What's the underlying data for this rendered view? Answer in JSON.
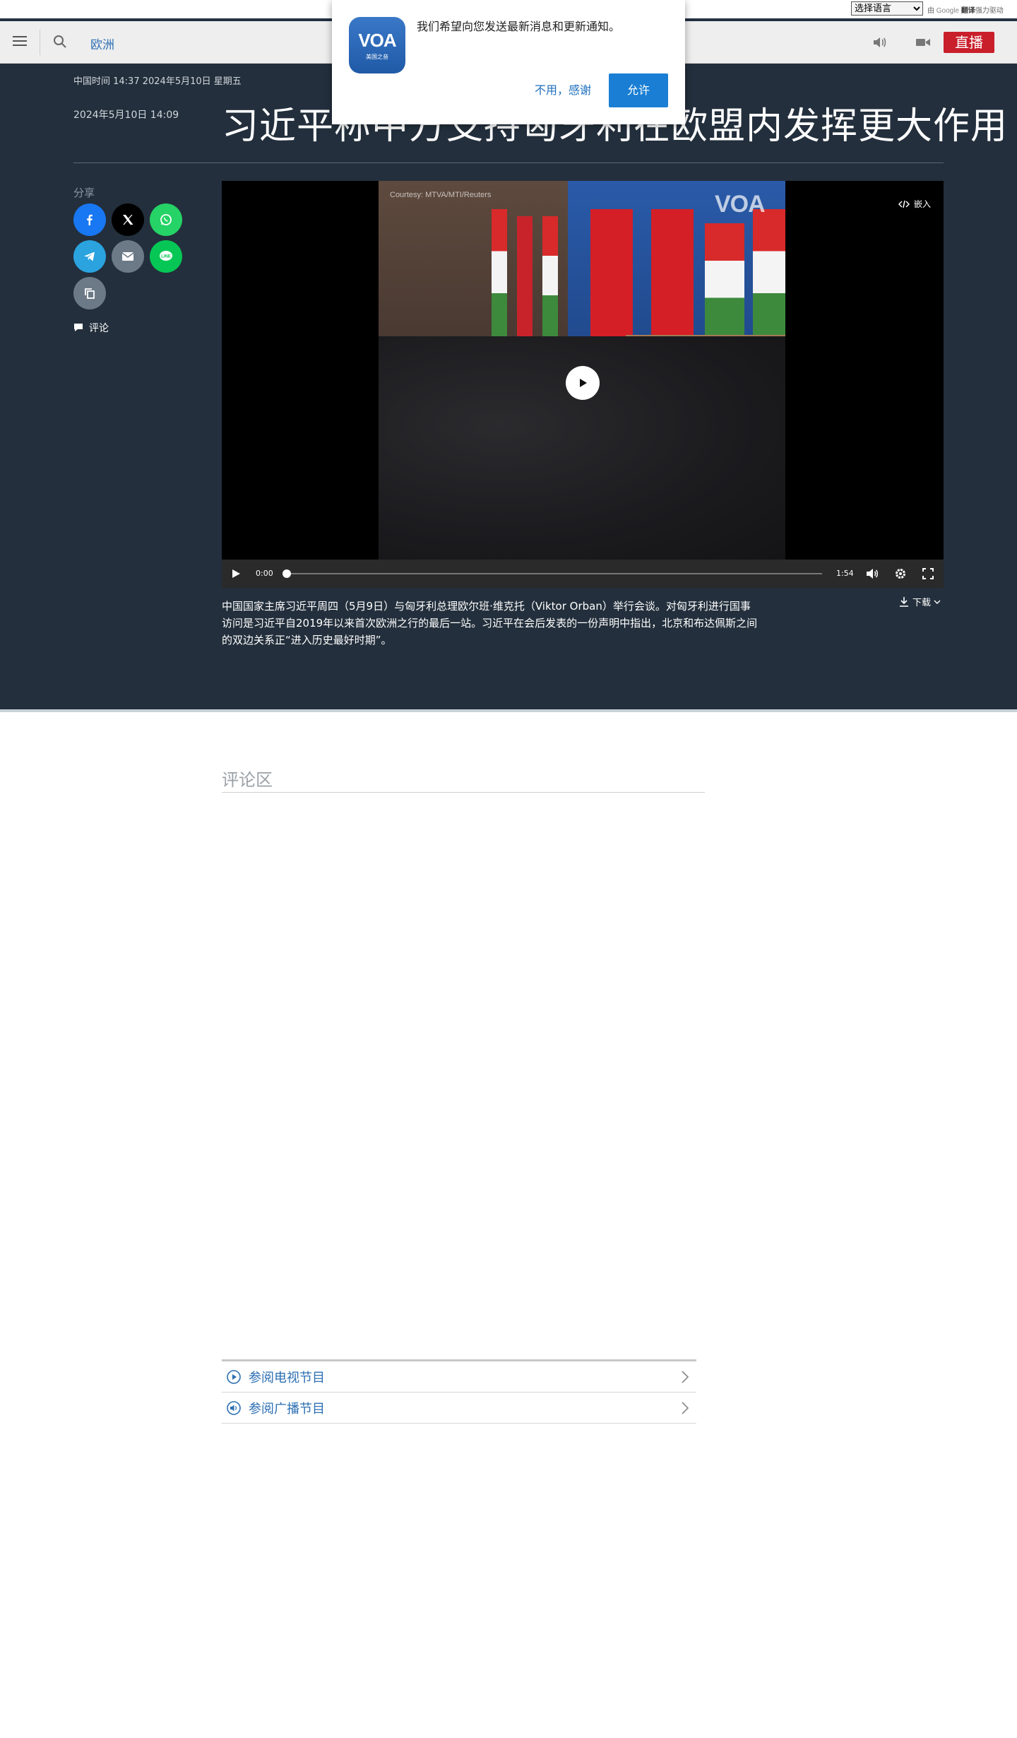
{
  "translate_bar": {
    "select_value": "选择语言",
    "powered_prefix": "由",
    "powered_google": "Google",
    "powered_fanyi": "翻译",
    "powered_suffix": "强力驱动"
  },
  "header": {
    "section_link": "欧洲",
    "live_label": "直播"
  },
  "notification": {
    "logo_text": "VOA",
    "logo_subtext": "美国之音",
    "message": "我们希望向您发送最新消息和更新通知。",
    "deny_label": "不用，感谢",
    "allow_label": "允许"
  },
  "article": {
    "top_datetime": "中国时间 14:37 2024年5月10日 星期五",
    "published": "2024年5月10日 14:09",
    "headline": "习近平称中方支持匈牙利在欧盟内发挥更大作用",
    "share_label": "分享",
    "comment_label": "评论",
    "caption": "中国国家主席习近平周四（5月9日）与匈牙利总理欧尔班·维克托（Viktor Orban）举行会谈。对匈牙利进行国事访问是习近平自2019年以来首次欧洲之行的最后一站。习近平在会后发表的一份声明中指出，北京和布达佩斯之间的双边关系正“进入历史最好时期”。",
    "download_label": "下载"
  },
  "video": {
    "embed_label": "嵌入",
    "watermark": "Courtesy: MTVA/MTI/Reuters",
    "voa_watermark": "VOA",
    "current_time": "0:00",
    "duration": "1:54"
  },
  "share_buttons": [
    {
      "name": "facebook",
      "color": "#1877f2"
    },
    {
      "name": "x",
      "color": "#000000"
    },
    {
      "name": "whatsapp",
      "color": "#25d366"
    },
    {
      "name": "telegram",
      "color": "#2aa3df"
    },
    {
      "name": "email",
      "color": "#6c7a88"
    },
    {
      "name": "line",
      "color": "#06c755"
    },
    {
      "name": "copy-link",
      "color": "#6c7a88"
    }
  ],
  "comments": {
    "title": "评论区"
  },
  "programs": [
    {
      "label": "参阅电视节目",
      "icon": "play-circle-icon"
    },
    {
      "label": "参阅广播节目",
      "icon": "speaker-circle-icon"
    }
  ],
  "colors": {
    "dark_bg": "#232f3c",
    "link_blue": "#2c6fb3",
    "live_red": "#c91f2b",
    "allow_blue": "#1a7fd4"
  }
}
